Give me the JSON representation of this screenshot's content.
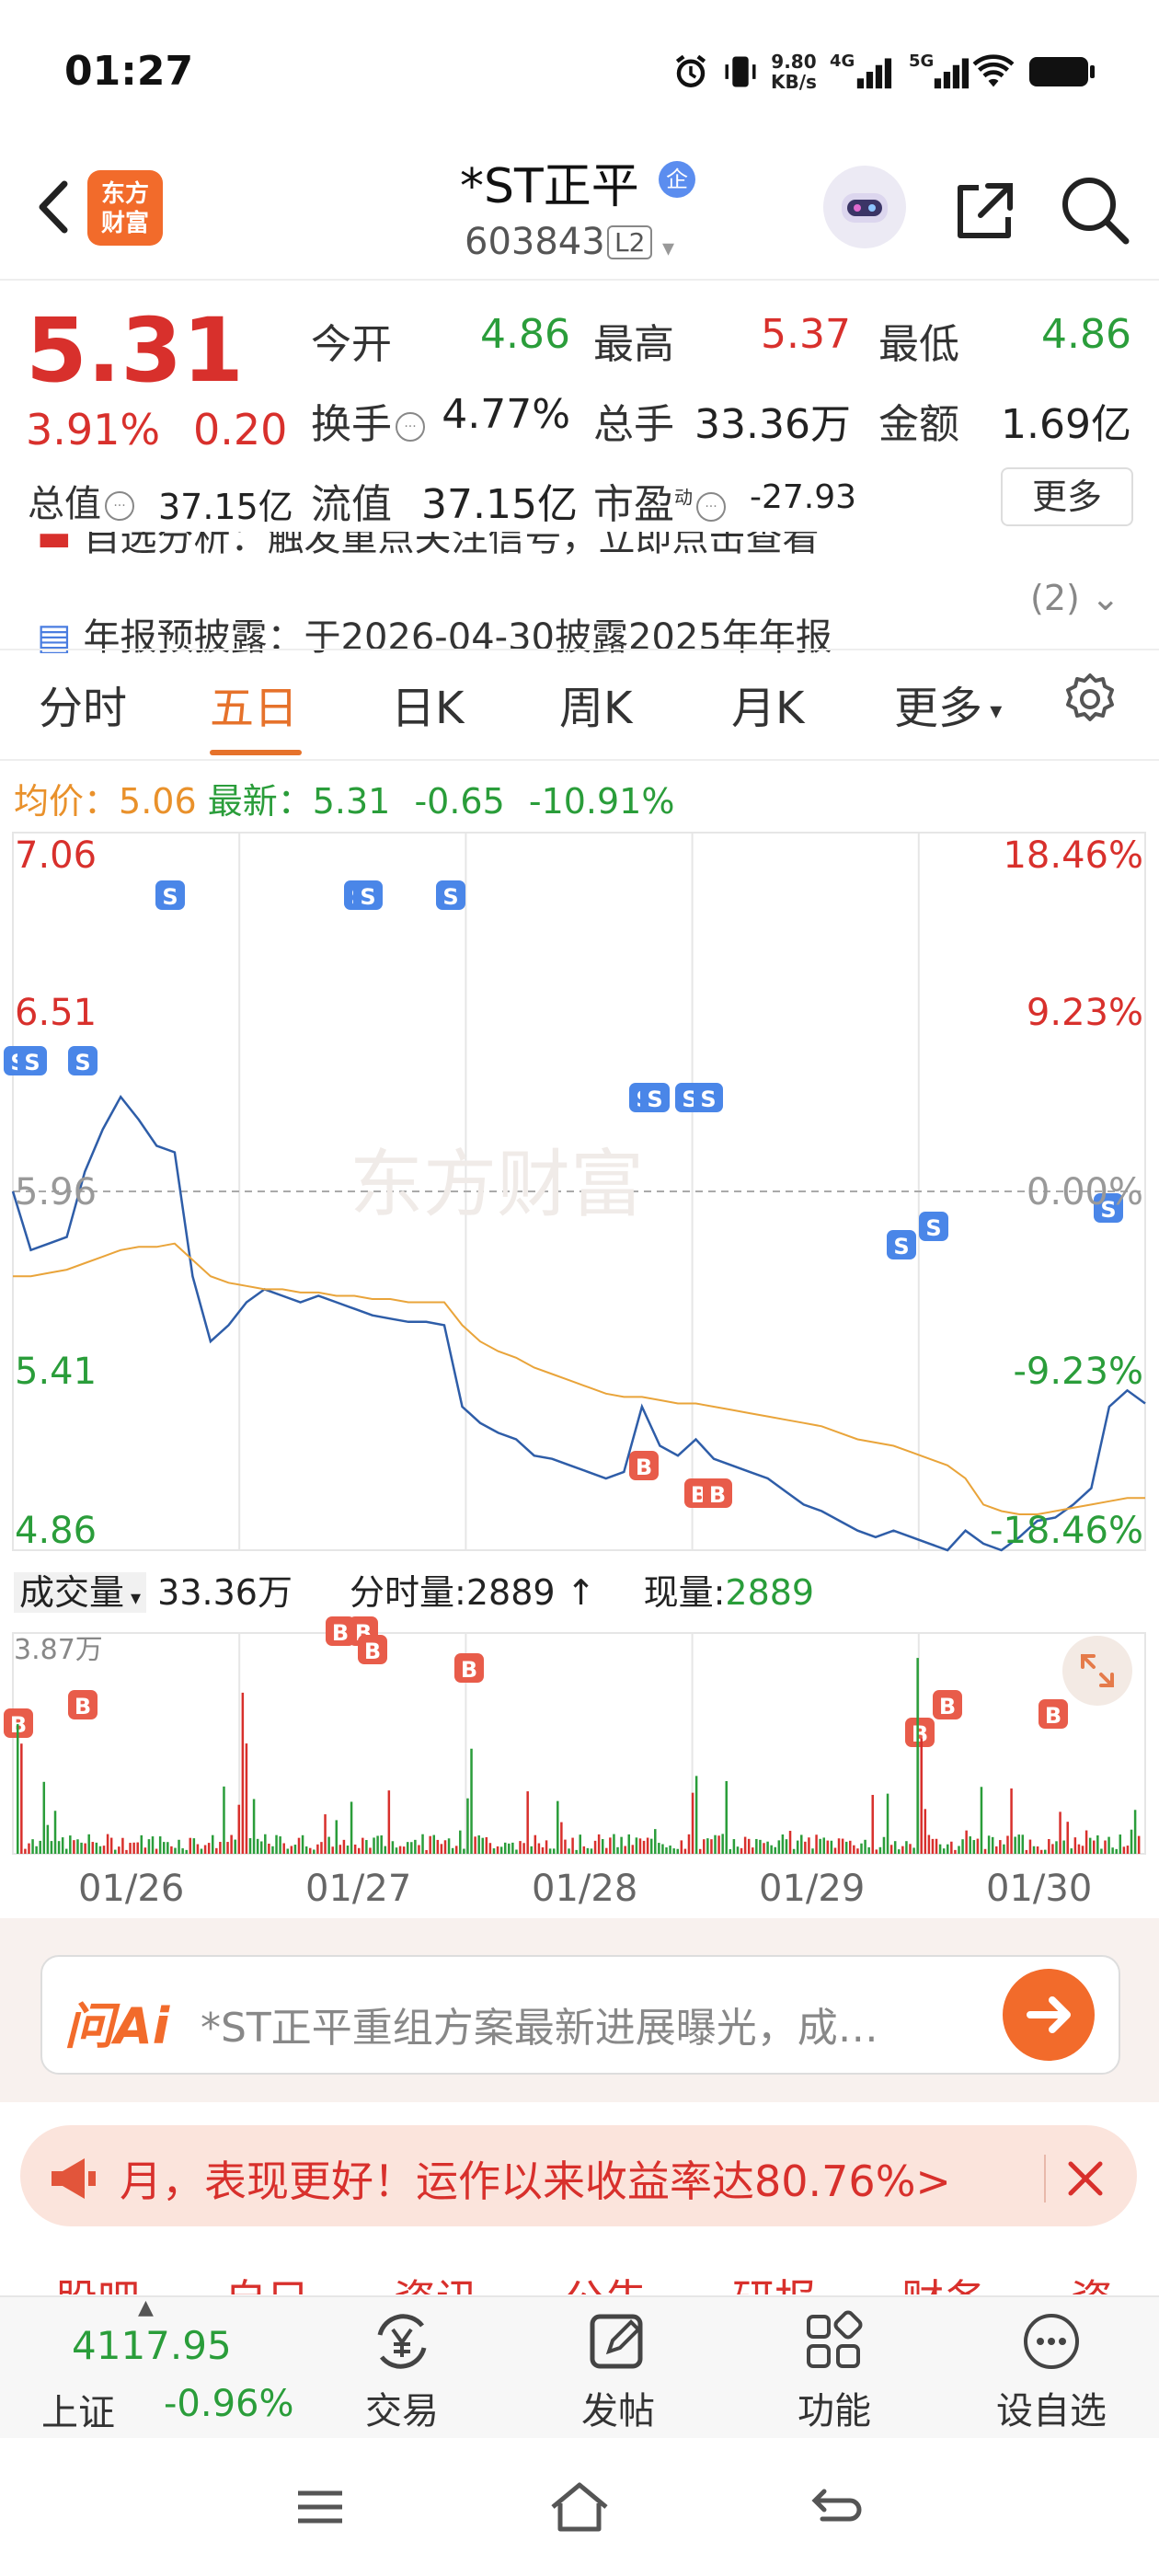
{
  "status": {
    "time": "01:27",
    "net_speed_top": "9.80",
    "net_speed_bottom": "KB/s",
    "sig1": "4G",
    "sig2": "5G"
  },
  "header": {
    "logo_top": "东方",
    "logo_bottom": "财富",
    "stock_name": "*ST正平",
    "badge": "企",
    "code": "603843",
    "level": "L2"
  },
  "quote": {
    "price": "5.31",
    "pct": "3.91%",
    "change": "0.20",
    "open_label": "今开",
    "open": "4.86",
    "high_label": "最高",
    "high": "5.37",
    "low_label": "最低",
    "low": "4.86",
    "turnover_label": "换手",
    "turnover": "4.77%",
    "volume_label": "总手",
    "volume": "33.36万",
    "amount_label": "金额",
    "amount": "1.69亿",
    "mktcap_label": "总值",
    "mktcap": "37.15亿",
    "float_label": "流值",
    "float": "37.15亿",
    "pe_label": "市盈",
    "pe_sup": "动",
    "pe": "-27.93",
    "more": "更多"
  },
  "ticker": {
    "line1": "自选分析：触发重点关注信号，立即点击查看",
    "line2": "年报预披露：于2026-04-30披露2025年年报",
    "count": "(2)"
  },
  "tabs": [
    "分时",
    "五日",
    "日K",
    "周K",
    "月K",
    "更多"
  ],
  "info": {
    "avg_label": "均价：",
    "avg": "5.06",
    "latest_label": "最新：",
    "latest": "5.31",
    "diff": "-0.65",
    "diff_pct": "-10.91%"
  },
  "chart_data": {
    "type": "line",
    "title": "",
    "y_left_ticks": [
      "7.06",
      "6.51",
      "5.96",
      "5.41",
      "4.86"
    ],
    "y_right_ticks": [
      "18.46%",
      "9.23%",
      "0.00%",
      "-9.23%",
      "-18.46%"
    ],
    "ylim": [
      4.86,
      7.06
    ],
    "reference_price": 5.96,
    "x_categories": [
      "01/26",
      "01/27",
      "01/28",
      "01/29",
      "01/30"
    ],
    "series": [
      {
        "name": "",
        "color": "#2e5da8",
        "values": [
          5.96,
          5.78,
          5.8,
          5.82,
          6.02,
          6.15,
          6.25,
          6.18,
          6.1,
          6.08,
          5.7,
          5.5,
          5.55,
          5.62,
          5.66,
          5.64,
          5.62,
          5.64,
          5.62,
          5.6,
          5.58,
          5.57,
          5.56,
          5.56,
          5.55,
          5.3,
          5.25,
          5.22,
          5.2,
          5.15,
          5.14,
          5.12,
          5.1,
          5.08,
          5.1,
          5.3,
          5.18,
          5.15,
          5.2,
          5.14,
          5.12,
          5.1,
          5.08,
          5.04,
          5.0,
          4.98,
          4.95,
          4.92,
          4.9,
          4.92,
          4.9,
          4.88,
          4.86,
          4.92,
          4.88,
          4.86,
          4.9,
          4.95,
          4.96,
          5.0,
          5.05,
          5.3,
          5.35,
          5.31
        ]
      },
      {
        "name": "",
        "color": "#e9a43a",
        "values": [
          5.7,
          5.7,
          5.71,
          5.72,
          5.74,
          5.76,
          5.78,
          5.79,
          5.79,
          5.8,
          5.75,
          5.7,
          5.68,
          5.67,
          5.66,
          5.66,
          5.65,
          5.65,
          5.64,
          5.64,
          5.63,
          5.63,
          5.62,
          5.62,
          5.62,
          5.55,
          5.5,
          5.47,
          5.45,
          5.42,
          5.4,
          5.38,
          5.36,
          5.34,
          5.33,
          5.33,
          5.32,
          5.31,
          5.31,
          5.3,
          5.29,
          5.28,
          5.27,
          5.26,
          5.25,
          5.24,
          5.22,
          5.2,
          5.19,
          5.18,
          5.16,
          5.14,
          5.12,
          5.08,
          5.0,
          4.98,
          4.97,
          4.97,
          4.98,
          4.99,
          5.0,
          5.01,
          5.02,
          5.02
        ]
      }
    ]
  },
  "volume": {
    "label": "成交量",
    "total": "33.36万",
    "tick_label": "分时量:",
    "tick_val": "2889",
    "now_label": "现量:",
    "now_val": "2889",
    "max": "3.87万"
  },
  "ai": {
    "logo": "问Ai",
    "text": "*ST正平重组方案最新进展曝光，成…"
  },
  "promo": {
    "text": "月，表现更好！运作以来收益率达80.76%>"
  },
  "subtabs": "股吧　　自只　　资讯　　公告　　研报　　财务　　资料",
  "bottom": {
    "index_value": "4117.95",
    "index_name": "上证",
    "index_pct": "-0.96%",
    "nav": [
      "交易",
      "发帖",
      "功能",
      "设自选"
    ]
  }
}
